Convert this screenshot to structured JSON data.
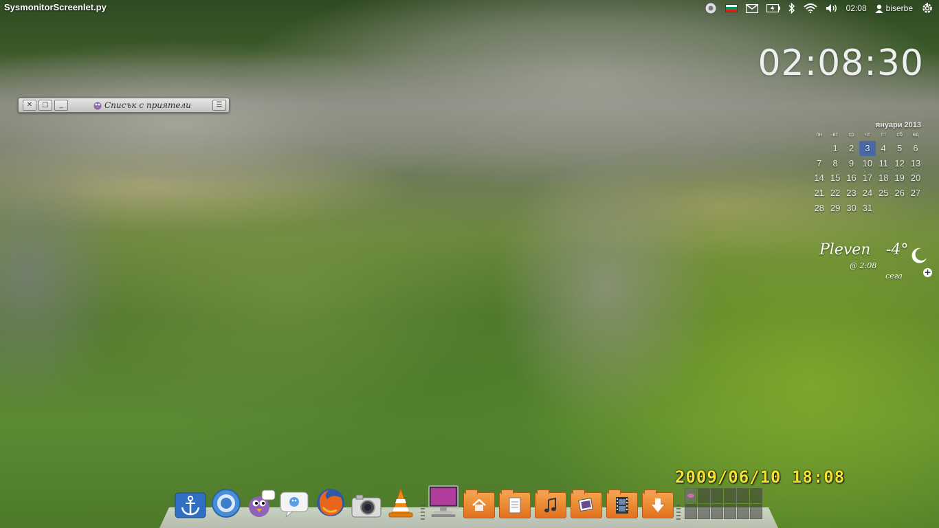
{
  "top_panel": {
    "app_title": "SysmonitorScreenlet.py",
    "clock": "02:08",
    "username": "biserbe",
    "icons": [
      "chromium-icon",
      "bulgarian-flag-icon",
      "mail-icon",
      "battery-icon",
      "bluetooth-icon",
      "wifi-icon",
      "volume-icon",
      "user-icon",
      "power-gear-icon"
    ],
    "flag_colors": [
      "#ffffff",
      "#00966e",
      "#d62612"
    ]
  },
  "desktop_clock": "02:08:30",
  "buddy_window": {
    "title": "Списък с приятели",
    "buttons": [
      "close-icon",
      "maximize-icon",
      "minimize-icon",
      "menu-icon"
    ]
  },
  "calendar": {
    "month_label": "януари 2013",
    "weekdays": [
      "пн",
      "вт",
      "ср",
      "чт",
      "пт",
      "сб",
      "нд"
    ],
    "leading_blanks": 1,
    "days": [
      "1",
      "2",
      "3",
      "4",
      "5",
      "6",
      "7",
      "8",
      "9",
      "10",
      "11",
      "12",
      "13",
      "14",
      "15",
      "16",
      "17",
      "18",
      "19",
      "20",
      "21",
      "22",
      "23",
      "24",
      "25",
      "26",
      "27",
      "28",
      "29",
      "30",
      "31"
    ],
    "today": "3",
    "highlight_color": "#4a68a4"
  },
  "weather": {
    "city": "Pleven",
    "temperature": "-4°",
    "updated": "@ 2:08",
    "now_label": "сега",
    "condition_icon": "moon-icon"
  },
  "photo_date": "2009/06/10 18:08",
  "dock": {
    "items": [
      "anchor-icon",
      "chromium-icon",
      "pidgin-icon",
      "chat-bubbles-icon",
      "empathy-icon",
      "firefox-icon",
      "camera-icon",
      "vlc-icon",
      "monitor-icon",
      "home-folder-icon",
      "documents-folder-icon",
      "music-folder-icon",
      "pictures-folder-icon",
      "videos-folder-icon",
      "downloads-folder-icon"
    ],
    "workspaces": 12,
    "active_workspace": 1
  }
}
